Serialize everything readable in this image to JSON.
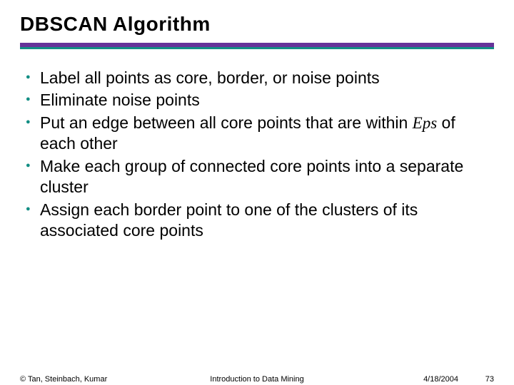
{
  "title": "DBSCAN Algorithm",
  "bullets": {
    "b0": "Label all points as core, border, or noise points",
    "b1": "Eliminate noise points",
    "b2_a": "Put an edge between all core points that are within ",
    "b2_eps": "Eps",
    "b2_b": " of each other",
    "b3": "Make each group of connected core points into a separate cluster",
    "b4": "Assign each border point to one of the clusters of its associated core points"
  },
  "footer": {
    "copyright": "© Tan, Steinbach, Kumar",
    "center": "Introduction to Data Mining",
    "date": "4/18/2004",
    "page": "73"
  }
}
